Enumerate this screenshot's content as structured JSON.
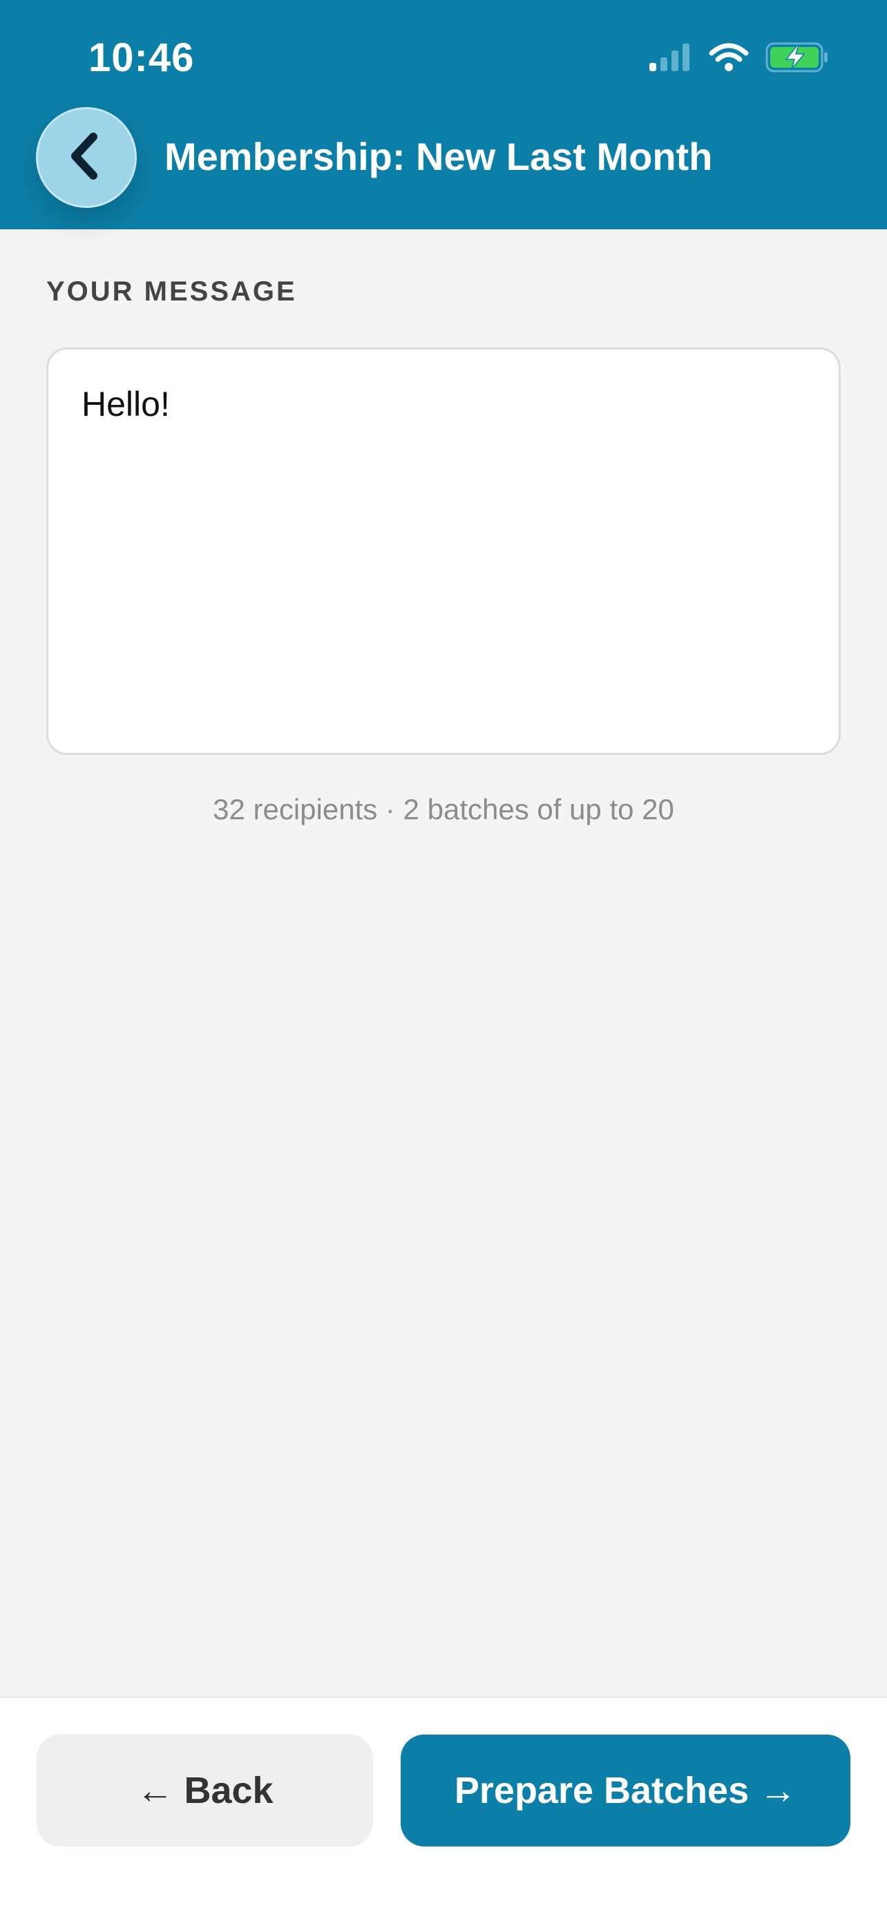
{
  "status_bar": {
    "time": "10:46",
    "icons": [
      "cellular-signal-icon",
      "wifi-icon",
      "battery-charging-icon"
    ]
  },
  "header": {
    "back_icon": "chevron-left-icon",
    "title": "Membership: New Last Month"
  },
  "message": {
    "label": "YOUR MESSAGE",
    "value": "Hello!"
  },
  "recipients_info": "32 recipients · 2 batches of up to 20",
  "footer": {
    "back_label": "← Back",
    "prepare_label": "Prepare Batches →"
  },
  "colors": {
    "primary": "#0c7fa8",
    "back_circle": "#9dd4e8",
    "background": "#f4f4f4"
  }
}
